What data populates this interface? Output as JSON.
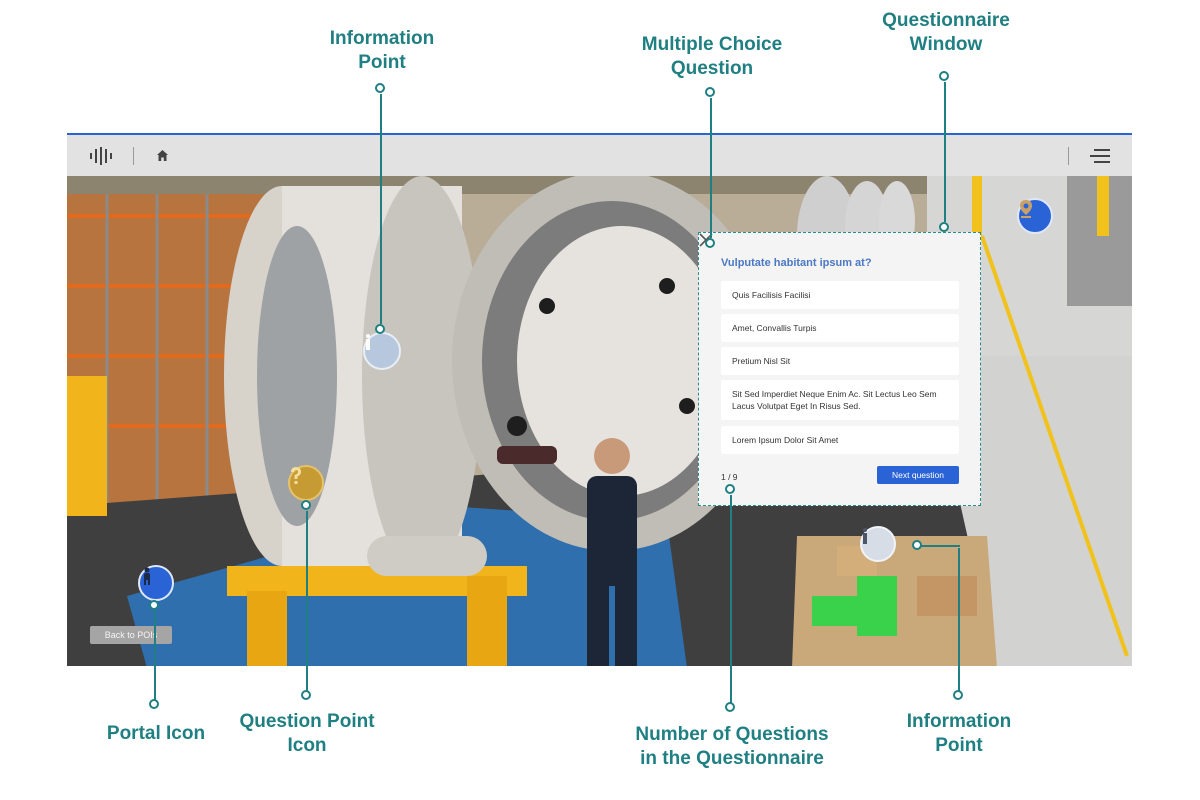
{
  "callouts": {
    "information_point_top": [
      "Information",
      "Point"
    ],
    "multiple_choice": [
      "Multiple Choice",
      "Question"
    ],
    "questionnaire_window": [
      "Questionnaire",
      "Window"
    ],
    "portal_icon": "Portal Icon",
    "question_point": [
      "Question Point",
      "Icon"
    ],
    "number_of_questions": [
      "Number of Questions",
      "in the Questionnaire"
    ],
    "information_point_bottom": [
      "Information",
      "Point"
    ]
  },
  "app": {
    "accent_color": "#2a63d6",
    "topbar_bg": "#e2e2e2",
    "icons": [
      "logo-icon",
      "home-icon",
      "hamburger-menu-icon"
    ]
  },
  "scene": {
    "back_button": "Back to POIs",
    "icons": [
      "information-point-icon",
      "question-point-icon",
      "portal-icon",
      "map-pin-portal-icon"
    ]
  },
  "questionnaire": {
    "question": "Vulputate habitant ipsum at?",
    "options": [
      "Quis Facilisis Facilisi",
      "Amet, Convallis Turpis",
      "Pretium Nisl Sit",
      "Sit Sed Imperdiet Neque Enim Ac. Sit Lectus Leo Sem Lacus Volutpat Eget In Risus Sed.",
      "Lorem Ipsum Dolor Sit Amet"
    ],
    "counter": "1 / 9",
    "next_label": "Next question"
  },
  "colors": {
    "callout_text": "#1f7f82",
    "question_title": "#4a78c4",
    "next_button": "#2a63d6"
  }
}
